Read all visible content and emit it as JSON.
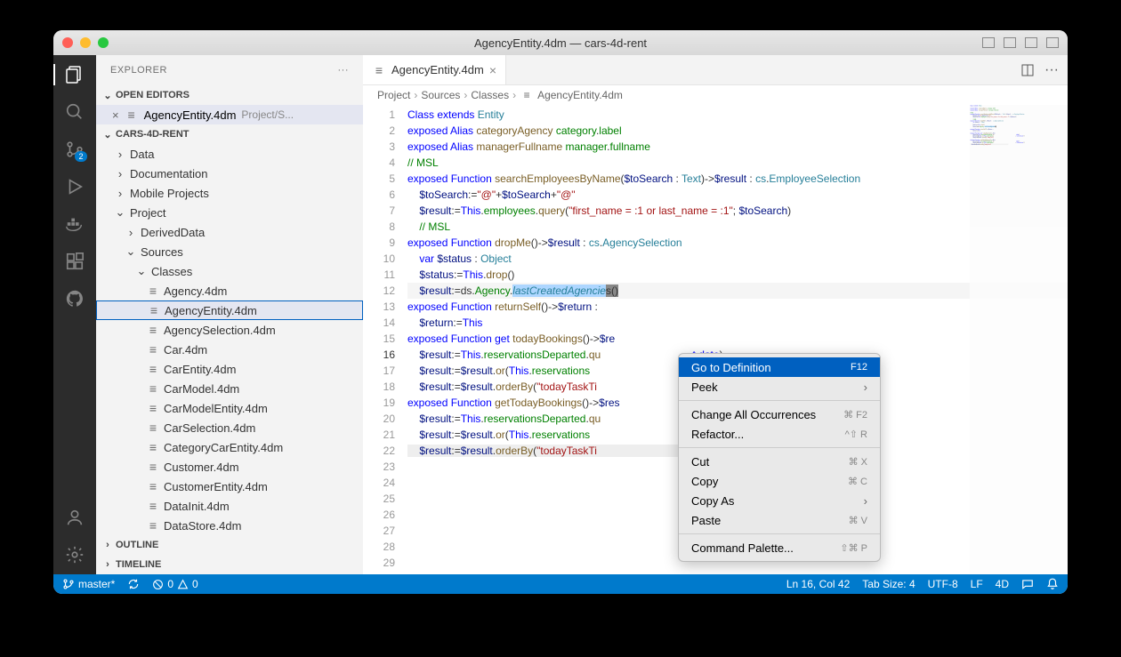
{
  "title": "AgencyEntity.4dm — cars-4d-rent",
  "sidebar": {
    "header": "EXPLORER",
    "open_editors_label": "OPEN EDITORS",
    "open_editor_file": "AgencyEntity.4dm",
    "open_editor_path": "Project/S...",
    "workspace": "CARS-4D-RENT",
    "outline_label": "OUTLINE",
    "timeline_label": "TIMELINE",
    "items": [
      {
        "label": "Data",
        "type": "folder",
        "indent": 0,
        "expanded": false
      },
      {
        "label": "Documentation",
        "type": "folder",
        "indent": 0,
        "expanded": false
      },
      {
        "label": "Mobile Projects",
        "type": "folder",
        "indent": 0,
        "expanded": false
      },
      {
        "label": "Project",
        "type": "folder",
        "indent": 0,
        "expanded": true
      },
      {
        "label": "DerivedData",
        "type": "folder",
        "indent": 1,
        "expanded": false
      },
      {
        "label": "Sources",
        "type": "folder",
        "indent": 1,
        "expanded": true
      },
      {
        "label": "Classes",
        "type": "folder",
        "indent": 2,
        "expanded": true
      },
      {
        "label": "Agency.4dm",
        "type": "file",
        "indent": 3
      },
      {
        "label": "AgencyEntity.4dm",
        "type": "file",
        "indent": 3,
        "selected": true
      },
      {
        "label": "AgencySelection.4dm",
        "type": "file",
        "indent": 3
      },
      {
        "label": "Car.4dm",
        "type": "file",
        "indent": 3
      },
      {
        "label": "CarEntity.4dm",
        "type": "file",
        "indent": 3
      },
      {
        "label": "CarModel.4dm",
        "type": "file",
        "indent": 3
      },
      {
        "label": "CarModelEntity.4dm",
        "type": "file",
        "indent": 3
      },
      {
        "label": "CarSelection.4dm",
        "type": "file",
        "indent": 3
      },
      {
        "label": "CategoryCarEntity.4dm",
        "type": "file",
        "indent": 3
      },
      {
        "label": "Customer.4dm",
        "type": "file",
        "indent": 3
      },
      {
        "label": "CustomerEntity.4dm",
        "type": "file",
        "indent": 3
      },
      {
        "label": "DataInit.4dm",
        "type": "file",
        "indent": 3
      },
      {
        "label": "DataStore.4dm",
        "type": "file",
        "indent": 3
      }
    ]
  },
  "activity_badge": "2",
  "tab": {
    "label": "AgencyEntity.4dm"
  },
  "breadcrumb": [
    "Project",
    "Sources",
    "Classes",
    "AgencyEntity.4dm"
  ],
  "context_menu": {
    "items": [
      {
        "label": "Go to Definition",
        "shortcut": "F12",
        "highlighted": true
      },
      {
        "label": "Peek",
        "submenu": true
      },
      {
        "sep": true
      },
      {
        "label": "Change All Occurrences",
        "shortcut": "⌘ F2"
      },
      {
        "label": "Refactor...",
        "shortcut": "^⇧ R"
      },
      {
        "sep": true
      },
      {
        "label": "Cut",
        "shortcut": "⌘ X"
      },
      {
        "label": "Copy",
        "shortcut": "⌘ C"
      },
      {
        "label": "Copy As",
        "submenu": true
      },
      {
        "label": "Paste",
        "shortcut": "⌘ V"
      },
      {
        "sep": true
      },
      {
        "label": "Command Palette...",
        "shortcut": "⇧⌘ P"
      }
    ]
  },
  "statusbar": {
    "branch": "master*",
    "errors": "0",
    "warnings": "0",
    "cursor": "Ln 16, Col 42",
    "tab_size": "Tab Size: 4",
    "encoding": "UTF-8",
    "eol": "LF",
    "lang": "4D"
  },
  "code_lines": 29
}
